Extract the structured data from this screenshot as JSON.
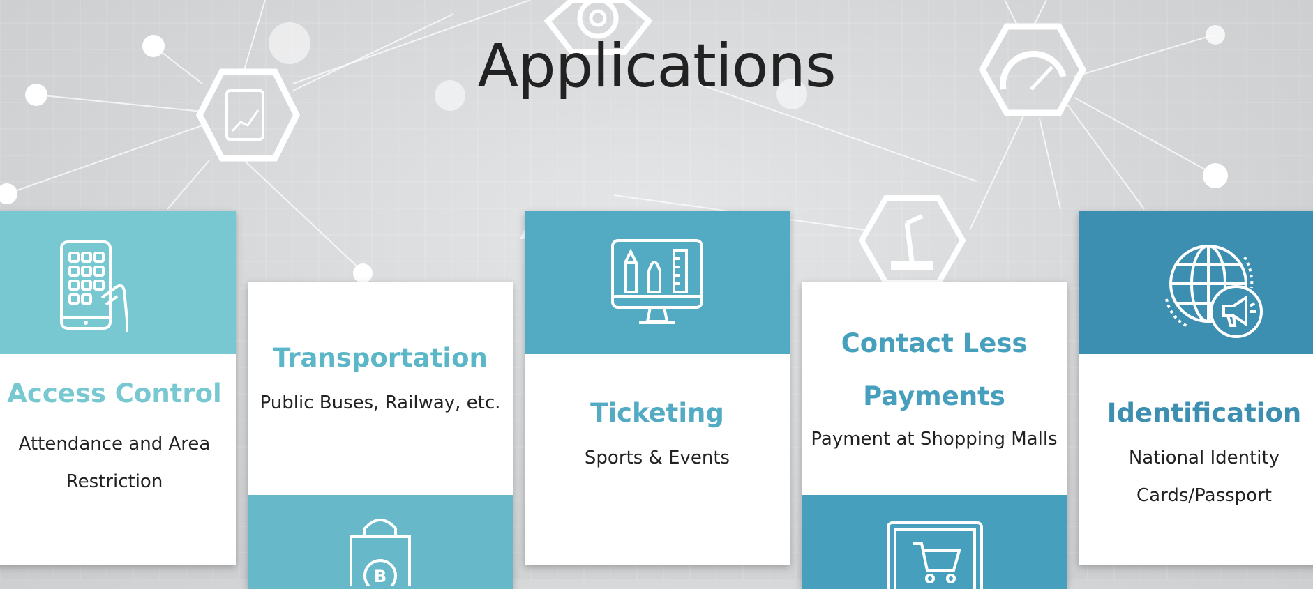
{
  "page": {
    "title": "Applications"
  },
  "colors": {
    "teal_light": "#77c8d0",
    "teal_mid": "#67b8c8",
    "teal_blue": "#52abc3",
    "blue_mid": "#469fbc",
    "blue_deep": "#3d8fb1",
    "title_text": "#222222"
  },
  "cards": [
    {
      "title": "Access Control",
      "description": "Attendance and Area Restriction",
      "icon": "keypad-phone-icon"
    },
    {
      "title": "Transportation",
      "description": "Public Buses, Railway, etc.",
      "icon": "shopping-bag-bitcoin-icon"
    },
    {
      "title": "Ticketing",
      "description": "Sports & Events",
      "icon": "monitor-design-tools-icon"
    },
    {
      "title": "Contact Less Payments",
      "description": "Payment at Shopping Malls",
      "icon": "cart-screen-icon"
    },
    {
      "title": "Identification",
      "description": "National Identity Cards/Passport",
      "icon": "globe-megaphone-icon"
    }
  ],
  "background_icons": [
    "gear-icon",
    "tablet-chart-icon",
    "gauge-icon",
    "robot-arm-icon"
  ]
}
